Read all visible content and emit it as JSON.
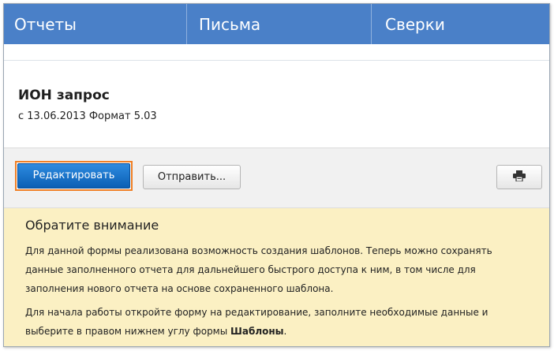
{
  "tabs": [
    {
      "label": "Отчеты"
    },
    {
      "label": "Письма"
    },
    {
      "label": "Сверки"
    }
  ],
  "document": {
    "title": "ИОН запрос",
    "subtitle": "с 13.06.2013 Формат 5.03"
  },
  "toolbar": {
    "edit_label": "Редактировать",
    "send_label": "Отправить...",
    "print_icon": "printer-icon"
  },
  "notice": {
    "title": "Обратите внимание",
    "paragraph1": "Для данной формы реализована возможность создания шаблонов. Теперь можно сохранять данные заполненного отчета для дальнейшего быстрого доступа к ним, в том числе для заполнения нового отчета на основе сохраненного шаблона.",
    "paragraph2_text": "Для начала работы откройте форму на редактирование, заполните необходимые данные и выберите в правом нижнем углу формы ",
    "paragraph2_bold": "Шаблоны",
    "paragraph2_end": "."
  },
  "colors": {
    "tab_bar": "#4a80c8",
    "primary_button": "#1a73c9",
    "focus_outline": "#f07f24",
    "notice_bg": "#fbf0c3"
  }
}
